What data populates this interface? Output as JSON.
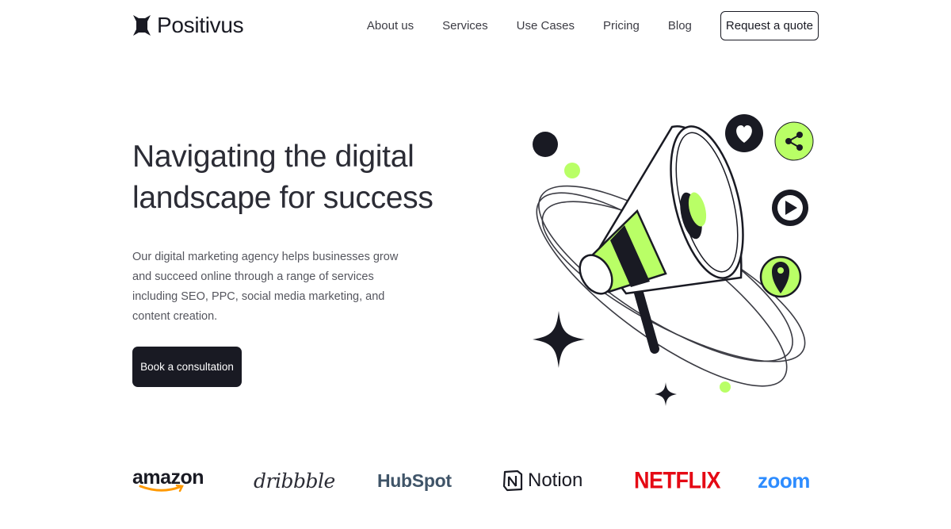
{
  "brand": {
    "name": "Positivus",
    "accent": "#B9FF66",
    "dark": "#191A23"
  },
  "nav": {
    "items": [
      {
        "label": "About us"
      },
      {
        "label": "Services"
      },
      {
        "label": "Use Cases"
      },
      {
        "label": "Pricing"
      },
      {
        "label": "Blog"
      }
    ],
    "cta_label": "Request a quote"
  },
  "hero": {
    "title_line1": "Navigating the digital",
    "title_line2": "landscape for success",
    "description": "Our digital marketing agency helps businesses grow and succeed online through a range of services including SEO, PPC, social media marketing, and content creation.",
    "cta_label": "Book a consultation"
  },
  "illustration": {
    "icons": [
      "megaphone-icon",
      "heart-icon",
      "share-icon",
      "play-icon",
      "location-pin-icon",
      "sparkle-icon"
    ]
  },
  "clients": {
    "amazon": "amazon",
    "dribbble": "dribbble",
    "hubspot": "HubSpot",
    "notion": "Notion",
    "netflix": "NETFLIX",
    "zoom": "zoom"
  }
}
